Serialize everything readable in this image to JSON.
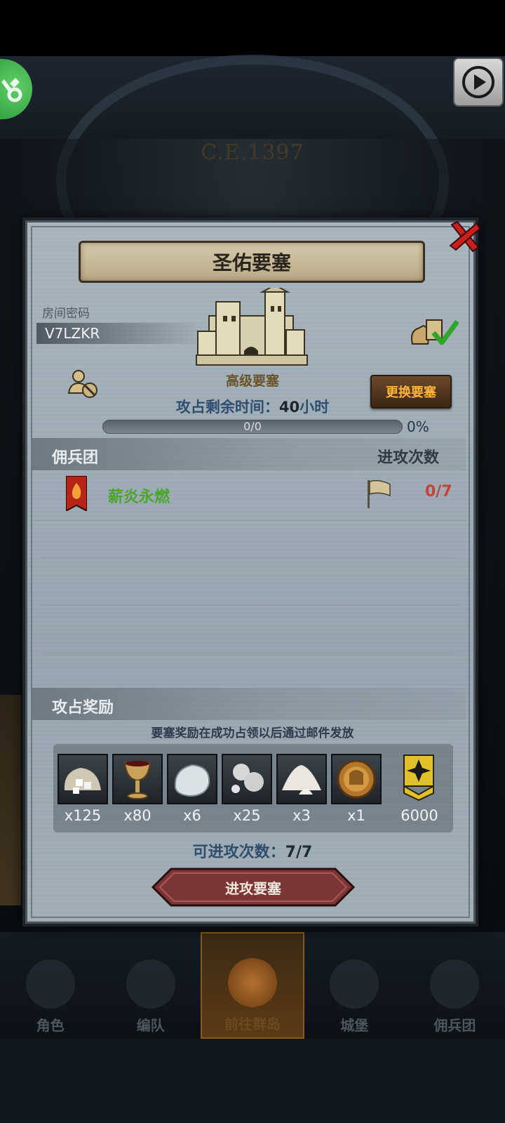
{
  "scene": {
    "era": "C.E.1397"
  },
  "dialog": {
    "title": "圣佑要塞",
    "room_label": "房间密码",
    "room_code": "V7LZKR",
    "fortress_level": "高级要塞",
    "remain_time_label": "攻占剩余时间：",
    "remain_time_value": "40",
    "remain_time_unit": "小时",
    "change_button": "更换要塞",
    "progress": {
      "text": "0/0",
      "percent_label": "0%",
      "fraction": 0
    },
    "mercenary_header": "佣兵团",
    "attack_count_header": "进攻次数",
    "mercenaries": [
      {
        "name": "薪炎永燃",
        "attacks": "0/7"
      }
    ],
    "reward_header": "攻占奖励",
    "reward_note": "要塞奖励在成功占领以后通过邮件发放",
    "rewards": [
      {
        "icon": "sugar-sack-icon",
        "qty": "x125"
      },
      {
        "icon": "goblet-icon",
        "qty": "x80"
      },
      {
        "icon": "moonstone-icon",
        "qty": "x6"
      },
      {
        "icon": "silver-nuggets-icon",
        "qty": "x25"
      },
      {
        "icon": "salt-pile-icon",
        "qty": "x3"
      },
      {
        "icon": "knight-medal-icon",
        "qty": "x1"
      },
      {
        "icon": "rank-badge-icon",
        "qty": "6000"
      }
    ],
    "attacks_left_label": "可进攻次数：",
    "attacks_left_value": "7/7",
    "attack_button": "进攻要塞"
  },
  "bottom_nav": [
    {
      "label": "角色",
      "active": false
    },
    {
      "label": "编队",
      "active": false
    },
    {
      "label": "前往群岛",
      "active": true
    },
    {
      "label": "城堡",
      "active": false
    },
    {
      "label": "佣兵团",
      "active": false
    }
  ],
  "colors": {
    "accent_orange": "#ffb43a",
    "merc_green": "#4aa52c",
    "count_red": "#c2453c",
    "attack_button": "#7a3534"
  }
}
